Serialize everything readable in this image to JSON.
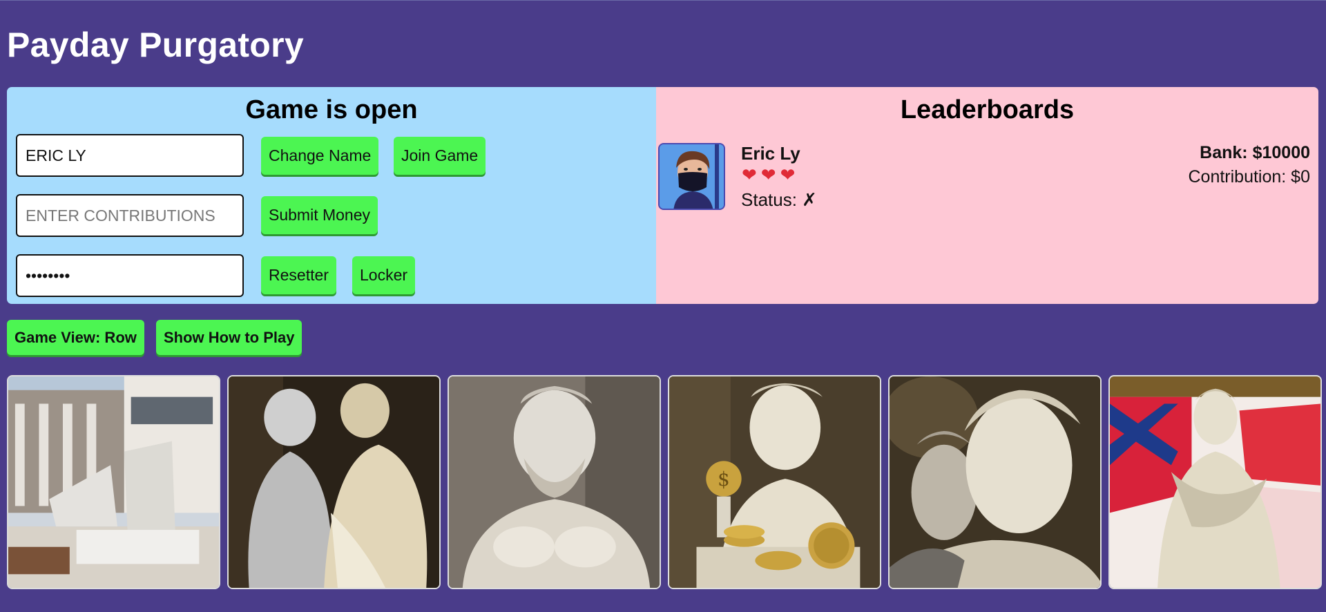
{
  "app": {
    "title": "Payday Purgatory"
  },
  "game_panel": {
    "title": "Game is open",
    "name_input": {
      "value": "ERIC LY",
      "placeholder": ""
    },
    "change_name_label": "Change Name",
    "join_game_label": "Join Game",
    "contribution_input": {
      "value": "",
      "placeholder": "ENTER CONTRIBUTIONS"
    },
    "submit_money_label": "Submit Money",
    "password_input": {
      "value": "12345678"
    },
    "resetter_label": "Resetter",
    "locker_label": "Locker"
  },
  "leaderboard": {
    "title": "Leaderboards",
    "players": [
      {
        "name": "Eric Ly",
        "hearts": "❤❤❤",
        "lives": 3,
        "status": "Status: ✗",
        "bank": "Bank: $10000",
        "contribution": "Contribution: $0"
      }
    ]
  },
  "controls": {
    "game_view_label": "Game View: Row",
    "how_to_play_label": "Show How to Play"
  },
  "gallery": {
    "images": [
      {
        "icon": "broken-monument-image"
      },
      {
        "icon": "two-statues-image"
      },
      {
        "icon": "bearded-statue-image"
      },
      {
        "icon": "statue-with-coins-image"
      },
      {
        "icon": "two-faces-statue-image"
      },
      {
        "icon": "statue-with-flag-image"
      }
    ]
  },
  "colors": {
    "background": "#4a3c8a",
    "game_panel": "#a6dcfd",
    "leaderboard_panel": "#fec8d5",
    "button": "#4cf552"
  }
}
